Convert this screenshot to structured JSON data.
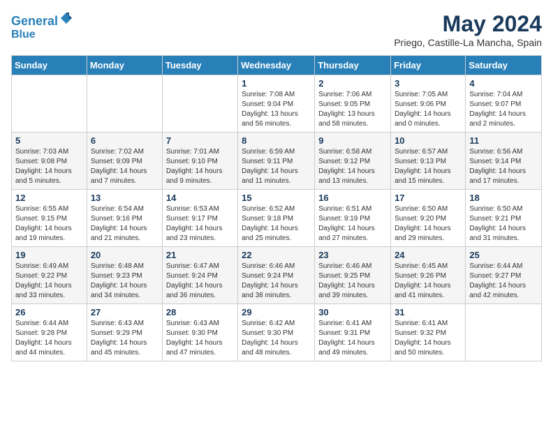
{
  "header": {
    "logo_line1": "General",
    "logo_line2": "Blue",
    "month_year": "May 2024",
    "location": "Priego, Castille-La Mancha, Spain"
  },
  "days_of_week": [
    "Sunday",
    "Monday",
    "Tuesday",
    "Wednesday",
    "Thursday",
    "Friday",
    "Saturday"
  ],
  "weeks": [
    [
      {
        "day": "",
        "info": ""
      },
      {
        "day": "",
        "info": ""
      },
      {
        "day": "",
        "info": ""
      },
      {
        "day": "1",
        "info": "Sunrise: 7:08 AM\nSunset: 9:04 PM\nDaylight: 13 hours\nand 56 minutes."
      },
      {
        "day": "2",
        "info": "Sunrise: 7:06 AM\nSunset: 9:05 PM\nDaylight: 13 hours\nand 58 minutes."
      },
      {
        "day": "3",
        "info": "Sunrise: 7:05 AM\nSunset: 9:06 PM\nDaylight: 14 hours\nand 0 minutes."
      },
      {
        "day": "4",
        "info": "Sunrise: 7:04 AM\nSunset: 9:07 PM\nDaylight: 14 hours\nand 2 minutes."
      }
    ],
    [
      {
        "day": "5",
        "info": "Sunrise: 7:03 AM\nSunset: 9:08 PM\nDaylight: 14 hours\nand 5 minutes."
      },
      {
        "day": "6",
        "info": "Sunrise: 7:02 AM\nSunset: 9:09 PM\nDaylight: 14 hours\nand 7 minutes."
      },
      {
        "day": "7",
        "info": "Sunrise: 7:01 AM\nSunset: 9:10 PM\nDaylight: 14 hours\nand 9 minutes."
      },
      {
        "day": "8",
        "info": "Sunrise: 6:59 AM\nSunset: 9:11 PM\nDaylight: 14 hours\nand 11 minutes."
      },
      {
        "day": "9",
        "info": "Sunrise: 6:58 AM\nSunset: 9:12 PM\nDaylight: 14 hours\nand 13 minutes."
      },
      {
        "day": "10",
        "info": "Sunrise: 6:57 AM\nSunset: 9:13 PM\nDaylight: 14 hours\nand 15 minutes."
      },
      {
        "day": "11",
        "info": "Sunrise: 6:56 AM\nSunset: 9:14 PM\nDaylight: 14 hours\nand 17 minutes."
      }
    ],
    [
      {
        "day": "12",
        "info": "Sunrise: 6:55 AM\nSunset: 9:15 PM\nDaylight: 14 hours\nand 19 minutes."
      },
      {
        "day": "13",
        "info": "Sunrise: 6:54 AM\nSunset: 9:16 PM\nDaylight: 14 hours\nand 21 minutes."
      },
      {
        "day": "14",
        "info": "Sunrise: 6:53 AM\nSunset: 9:17 PM\nDaylight: 14 hours\nand 23 minutes."
      },
      {
        "day": "15",
        "info": "Sunrise: 6:52 AM\nSunset: 9:18 PM\nDaylight: 14 hours\nand 25 minutes."
      },
      {
        "day": "16",
        "info": "Sunrise: 6:51 AM\nSunset: 9:19 PM\nDaylight: 14 hours\nand 27 minutes."
      },
      {
        "day": "17",
        "info": "Sunrise: 6:50 AM\nSunset: 9:20 PM\nDaylight: 14 hours\nand 29 minutes."
      },
      {
        "day": "18",
        "info": "Sunrise: 6:50 AM\nSunset: 9:21 PM\nDaylight: 14 hours\nand 31 minutes."
      }
    ],
    [
      {
        "day": "19",
        "info": "Sunrise: 6:49 AM\nSunset: 9:22 PM\nDaylight: 14 hours\nand 33 minutes."
      },
      {
        "day": "20",
        "info": "Sunrise: 6:48 AM\nSunset: 9:23 PM\nDaylight: 14 hours\nand 34 minutes."
      },
      {
        "day": "21",
        "info": "Sunrise: 6:47 AM\nSunset: 9:24 PM\nDaylight: 14 hours\nand 36 minutes."
      },
      {
        "day": "22",
        "info": "Sunrise: 6:46 AM\nSunset: 9:24 PM\nDaylight: 14 hours\nand 38 minutes."
      },
      {
        "day": "23",
        "info": "Sunrise: 6:46 AM\nSunset: 9:25 PM\nDaylight: 14 hours\nand 39 minutes."
      },
      {
        "day": "24",
        "info": "Sunrise: 6:45 AM\nSunset: 9:26 PM\nDaylight: 14 hours\nand 41 minutes."
      },
      {
        "day": "25",
        "info": "Sunrise: 6:44 AM\nSunset: 9:27 PM\nDaylight: 14 hours\nand 42 minutes."
      }
    ],
    [
      {
        "day": "26",
        "info": "Sunrise: 6:44 AM\nSunset: 9:28 PM\nDaylight: 14 hours\nand 44 minutes."
      },
      {
        "day": "27",
        "info": "Sunrise: 6:43 AM\nSunset: 9:29 PM\nDaylight: 14 hours\nand 45 minutes."
      },
      {
        "day": "28",
        "info": "Sunrise: 6:43 AM\nSunset: 9:30 PM\nDaylight: 14 hours\nand 47 minutes."
      },
      {
        "day": "29",
        "info": "Sunrise: 6:42 AM\nSunset: 9:30 PM\nDaylight: 14 hours\nand 48 minutes."
      },
      {
        "day": "30",
        "info": "Sunrise: 6:41 AM\nSunset: 9:31 PM\nDaylight: 14 hours\nand 49 minutes."
      },
      {
        "day": "31",
        "info": "Sunrise: 6:41 AM\nSunset: 9:32 PM\nDaylight: 14 hours\nand 50 minutes."
      },
      {
        "day": "",
        "info": ""
      }
    ]
  ]
}
